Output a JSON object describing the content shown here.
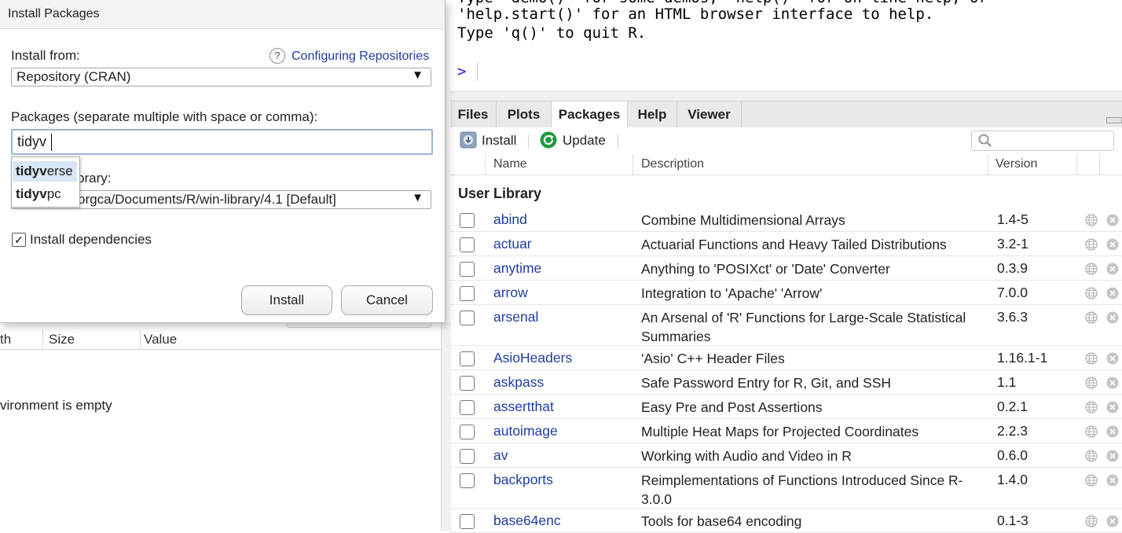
{
  "console": {
    "lines": [
      "Type 'demo()' for some demos, 'help()' for on-line help, or",
      "'help.start()' for an HTML browser interface to help.",
      "Type 'q()' to quit R."
    ],
    "prompt": ">"
  },
  "environment": {
    "columns": [
      "th",
      "Size",
      "Value"
    ],
    "empty_message": "vironment is empty"
  },
  "packages_pane": {
    "tabs": [
      "Files",
      "Plots",
      "Packages",
      "Help",
      "Viewer"
    ],
    "active_tab": "Packages",
    "toolbar": {
      "install_label": "Install",
      "update_label": "Update"
    },
    "columns": {
      "name": "Name",
      "description": "Description",
      "version": "Version"
    },
    "section": "User Library",
    "packages": [
      {
        "name": "abind",
        "description": "Combine Multidimensional Arrays",
        "version": "1.4-5"
      },
      {
        "name": "actuar",
        "description": "Actuarial Functions and Heavy Tailed Distributions",
        "version": "3.2-1"
      },
      {
        "name": "anytime",
        "description": "Anything to 'POSIXct' or 'Date' Converter",
        "version": "0.3.9"
      },
      {
        "name": "arrow",
        "description": "Integration to 'Apache' 'Arrow'",
        "version": "7.0.0"
      },
      {
        "name": "arsenal",
        "description": "An Arsenal of 'R' Functions for Large-Scale Statistical Summaries",
        "version": "3.6.3"
      },
      {
        "name": "AsioHeaders",
        "description": "'Asio' C++ Header Files",
        "version": "1.16.1-1"
      },
      {
        "name": "askpass",
        "description": "Safe Password Entry for R, Git, and SSH",
        "version": "1.1"
      },
      {
        "name": "assertthat",
        "description": "Easy Pre and Post Assertions",
        "version": "0.2.1"
      },
      {
        "name": "autoimage",
        "description": "Multiple Heat Maps for Projected Coordinates",
        "version": "2.2.3"
      },
      {
        "name": "av",
        "description": "Working with Audio and Video in R",
        "version": "0.6.0"
      },
      {
        "name": "backports",
        "description": "Reimplementations of Functions Introduced Since R-3.0.0",
        "version": "1.4.0"
      },
      {
        "name": "base64enc",
        "description": "Tools for base64 encoding",
        "version": "0.1-3"
      }
    ]
  },
  "dialog": {
    "title": "Install Packages",
    "install_from_label": "Install from:",
    "configuring_link": "Configuring Repositories",
    "install_from_value": "Repository (CRAN)",
    "packages_label": "Packages (separate multiple with space or comma):",
    "packages_value": "tidyv",
    "suggestions": [
      {
        "match": "tidyv",
        "rest": "erse"
      },
      {
        "match": "tidyv",
        "rest": "pc"
      }
    ],
    "library_label_partial": "brary:",
    "library_value": "orgca/Documents/R/win-library/4.1 [Default]",
    "dependencies_label": "Install dependencies",
    "dependencies_checked": true,
    "install_button": "Install",
    "cancel_button": "Cancel"
  }
}
